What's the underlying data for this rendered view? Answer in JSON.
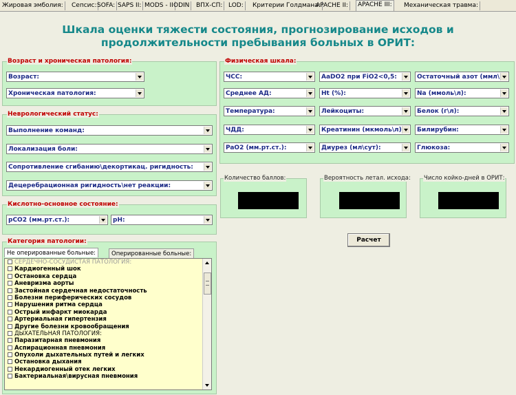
{
  "tabs": [
    "Жировая эмболия:",
    "Сепсис:",
    "SOFA:",
    "SAPS II:",
    "MODS - II",
    "ODIN",
    "ВПХ-СП:",
    "LOD:",
    "Критерии Голдмана:",
    "APACHE II:",
    "APACHE III:",
    "Механическая травма:"
  ],
  "active_tab": "APACHE III:",
  "title_line1": "Шкала оценки тяжести состояния, прогнозирование исходов и",
  "title_line2": "продолжительности пребывания больных в ОРИТ:",
  "groups": {
    "age": {
      "title": "Возраст и хроническая патология:",
      "fields": [
        "Возраст:",
        "Хроническая патология:"
      ]
    },
    "neuro": {
      "title": "Неврологический статус:",
      "fields": [
        "Выполнение команд:",
        "Локализация боли:",
        "Сопротивление сгибанию\\декортикац. ригидность:",
        "Децеребрационная ригидность\\нет реакции:"
      ]
    },
    "acid": {
      "title": "Кислотно-основное состояние:",
      "fields": [
        "рCO2 (мм.рт.ст.):",
        "pH:"
      ]
    },
    "physical": {
      "title": "Физическая шкала:",
      "col1": [
        "ЧСС:",
        "Среднее АД:",
        "Температура:",
        "ЧДД:",
        "PaO2 (мм.рт.ст.):"
      ],
      "col2": [
        "AaDO2 при FiO2<0,5:",
        "Ht (%):",
        "Лейкоциты:",
        "Креатинин (мкмоль\\л):",
        "Диурез (мл\\сут):"
      ],
      "col3": [
        "Остаточный азот (ммл\\л):",
        "Na (ммоль\\л):",
        "Белок (г\\л):",
        "Билирубин:",
        "Глюкоза:"
      ]
    }
  },
  "results": {
    "score": "Количество баллов:",
    "mortality": "Вероятность летал. исхода:",
    "days": "Число койко-дней в ОРИТ:"
  },
  "calc_button": "Расчет",
  "category": {
    "title": "Категория патологии:",
    "tabs": [
      "Не оперированные больные:",
      "Оперированные больные:"
    ],
    "items": [
      {
        "text": "СЕРДЕЧНО-СОСУДИСТАЯ ПАТОЛОГИЯ:",
        "kind": "cat-grey"
      },
      {
        "text": "Кардиогенный шок",
        "kind": "item"
      },
      {
        "text": "Остановка сердца",
        "kind": "item"
      },
      {
        "text": "Аневризма аорты",
        "kind": "item"
      },
      {
        "text": "Застойная сердечная недостаточность",
        "kind": "item"
      },
      {
        "text": "Болезни периферических сосудов",
        "kind": "item"
      },
      {
        "text": "Нарушения ритма сердца",
        "kind": "item"
      },
      {
        "text": "Острый инфаркт миокарда",
        "kind": "item"
      },
      {
        "text": "Артериальная гипертензия",
        "kind": "item"
      },
      {
        "text": "Другие болезни кровообращения",
        "kind": "item"
      },
      {
        "text": "ДЫХАТЕЛЬНАЯ ПАТОЛОГИЯ:",
        "kind": "cat"
      },
      {
        "text": "Паразитарная пневмония",
        "kind": "item"
      },
      {
        "text": "Аспирационная пневмония",
        "kind": "item"
      },
      {
        "text": "Опухоли дыхательных путей и легких",
        "kind": "item"
      },
      {
        "text": "Остановка дыхания",
        "kind": "item"
      },
      {
        "text": "Некардиогенный отек легких",
        "kind": "item"
      },
      {
        "text": "Бактериальная\\вирусная пневмония",
        "kind": "item"
      }
    ]
  }
}
